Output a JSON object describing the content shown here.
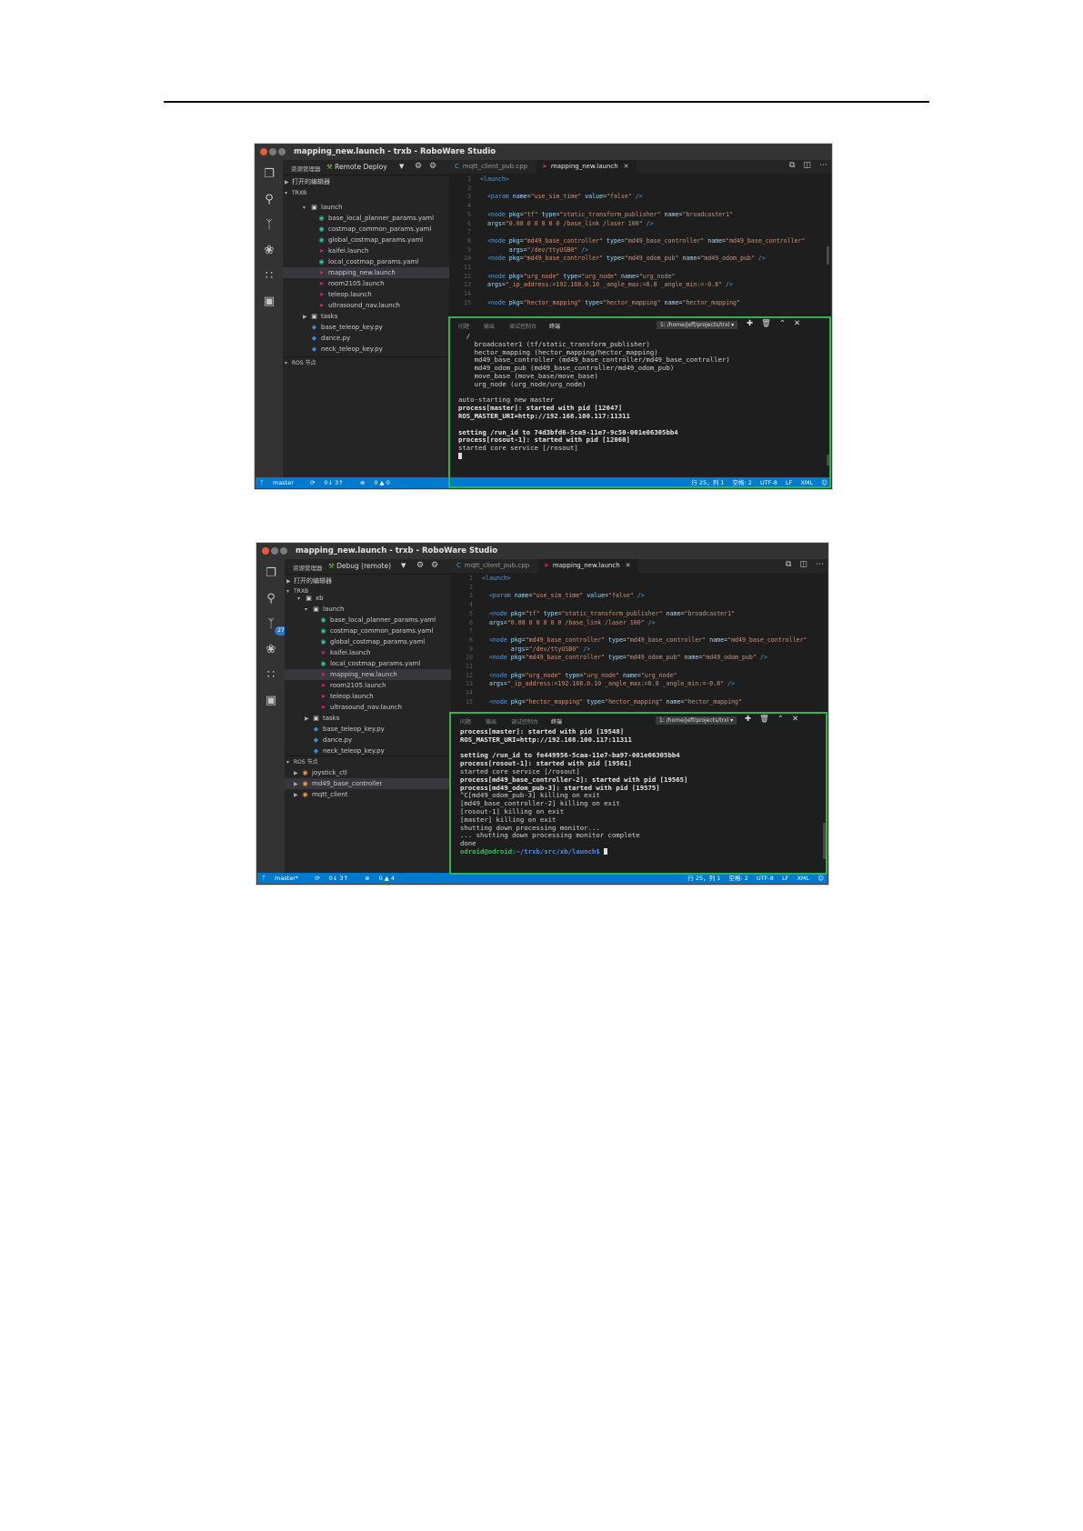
{
  "colors": {
    "accent": "#007acc",
    "highlight_box": "#2fb34a",
    "prompt_green": "#39c057"
  },
  "windows": [
    {
      "title": "mapping_new.launch - trxb - RoboWare Studio",
      "sidebar": {
        "header": "资源管理器",
        "mode": "Remote Deploy",
        "tree": [
          {
            "label": "打开的编辑器",
            "kind": "section"
          },
          {
            "label": "TRXB",
            "kind": "section"
          },
          {
            "label": "launch",
            "kind": "folder"
          },
          {
            "label": "base_local_planner_params.yaml",
            "kind": "yaml"
          },
          {
            "label": "costmap_common_params.yaml",
            "kind": "yaml"
          },
          {
            "label": "global_costmap_params.yaml",
            "kind": "yaml"
          },
          {
            "label": "kaifei.launch",
            "kind": "launch"
          },
          {
            "label": "local_costmap_params.yaml",
            "kind": "yaml"
          },
          {
            "label": "mapping_new.launch",
            "kind": "launch",
            "selected": true
          },
          {
            "label": "room2105.launch",
            "kind": "launch"
          },
          {
            "label": "teleop.launch",
            "kind": "launch"
          },
          {
            "label": "ultrasound_nav.launch",
            "kind": "launch"
          },
          {
            "label": "tasks",
            "kind": "folder"
          },
          {
            "label": "base_teleop_key.py",
            "kind": "py"
          },
          {
            "label": "dance.py",
            "kind": "py"
          },
          {
            "label": "neck_teleop_key.py",
            "kind": "py"
          },
          {
            "label": "ROS 节点",
            "kind": "section"
          }
        ]
      },
      "tabs": [
        {
          "label": "mqtt_client_pub.cpp",
          "active": false
        },
        {
          "label": "mapping_new.launch",
          "active": true
        }
      ],
      "panel": {
        "tabs": [
          "问题",
          "输出",
          "调试控制台",
          "终端"
        ],
        "active_tab": "终端",
        "terminal_select": "1: /home/jeff/projects/trxl",
        "lines": [
          "  /",
          "    broadcaster1 (tf/static_transform_publisher)",
          "    hector_mapping (hector_mapping/hector_mapping)",
          "    md49_base_controller (md49_base_controller/md49_base_controller)",
          "    md49_odom_pub (md49_base_controller/md49_odom_pub)",
          "    move_base (move_base/move_base)",
          "    urg_node (urg_node/urg_node)",
          "",
          "auto-starting new master",
          "process[master]: started with pid [12047]",
          "ROS_MASTER_URI=http://192.168.100.117:11311",
          "",
          "setting /run_id to 74d3bfd6-5ca9-11e7-9c50-001e06305bb4",
          "process[rosout-1]: started with pid [12060]",
          "started core service [/rosout]"
        ],
        "bold_lines": [
          9,
          10,
          12,
          13
        ]
      },
      "status": {
        "branch": "master",
        "sync": "0↓ 3↑",
        "problems": "0 ▲ 0",
        "position": "行 25，列 1",
        "indent": "空格: 2",
        "encoding": "UTF-8",
        "eol": "LF",
        "lang": "XML"
      }
    },
    {
      "title": "mapping_new.launch - trxb - RoboWare Studio",
      "sidebar": {
        "header": "资源管理器",
        "mode": "Debug (remote)",
        "badge": "27",
        "tree": [
          {
            "label": "打开的编辑器",
            "kind": "section"
          },
          {
            "label": "TRXB",
            "kind": "section"
          },
          {
            "label": "xb",
            "kind": "folder"
          },
          {
            "label": "launch",
            "kind": "folder"
          },
          {
            "label": "base_local_planner_params.yaml",
            "kind": "yaml"
          },
          {
            "label": "costmap_common_params.yaml",
            "kind": "yaml"
          },
          {
            "label": "global_costmap_params.yaml",
            "kind": "yaml"
          },
          {
            "label": "kaifei.launch",
            "kind": "launch"
          },
          {
            "label": "local_costmap_params.yaml",
            "kind": "yaml"
          },
          {
            "label": "mapping_new.launch",
            "kind": "launch",
            "selected": true
          },
          {
            "label": "room2105.launch",
            "kind": "launch"
          },
          {
            "label": "teleop.launch",
            "kind": "launch"
          },
          {
            "label": "ultrasound_nav.launch",
            "kind": "launch"
          },
          {
            "label": "tasks",
            "kind": "folder"
          },
          {
            "label": "base_teleop_key.py",
            "kind": "py"
          },
          {
            "label": "dance.py",
            "kind": "py"
          },
          {
            "label": "neck_teleop_key.py",
            "kind": "py"
          },
          {
            "label": "ROS 节点",
            "kind": "section"
          },
          {
            "label": "joystick_ctl",
            "kind": "pkg"
          },
          {
            "label": "md49_base_controller",
            "kind": "pkg",
            "selected": true
          },
          {
            "label": "mqtt_client",
            "kind": "pkg"
          }
        ]
      },
      "tabs": [
        {
          "label": "mqtt_client_pub.cpp",
          "active": false
        },
        {
          "label": "mapping_new.launch",
          "active": true
        }
      ],
      "panel": {
        "tabs": [
          "问题",
          "输出",
          "调试控制台",
          "终端"
        ],
        "active_tab": "终端",
        "terminal_select": "1: /home/jeff/projects/trxl",
        "lines": [
          "process[master]: started with pid [19548]",
          "ROS_MASTER_URI=http://192.168.100.117:11311",
          "",
          "setting /run_id to fe449956-5caa-11e7-ba97-001e06305bb4",
          "process[rosout-1]: started with pid [19561]",
          "started core service [/rosout]",
          "process[md49_base_controller-2]: started with pid [19565]",
          "process[md49_odom_pub-3]: started with pid [19575]",
          "^C[md49_odom_pub-3] killing on exit",
          "[md49_base_controller-2] killing on exit",
          "[rosout-1] killing on exit",
          "[master] killing on exit",
          "shutting down processing monitor...",
          "... shutting down processing monitor complete",
          "done"
        ],
        "bold_lines": [
          0,
          1,
          3,
          4,
          6,
          7
        ],
        "prompt_user": "odroid@odroid",
        "prompt_path": ":~/trxb/src/xb/launch$"
      },
      "status": {
        "branch": "master*",
        "sync": "0↓ 3↑",
        "problems": "0 ▲ 4",
        "position": "行 25，列 1",
        "indent": "空格: 2",
        "encoding": "UTF-8",
        "eol": "LF",
        "lang": "XML"
      }
    }
  ],
  "editor": {
    "lines": [
      {
        "n": "1",
        "text": "<launch>"
      },
      {
        "n": "2",
        "text": ""
      },
      {
        "n": "3",
        "text": "  <param name=\"use_sim_time\" value=\"false\" />"
      },
      {
        "n": "4",
        "text": ""
      },
      {
        "n": "5",
        "text": "  <node pkg=\"tf\" type=\"static_transform_publisher\" name=\"broadcaster1\""
      },
      {
        "n": "6",
        "text": "  args=\"0.08 0 0 0 0 0 /base_link /laser 100\" />"
      },
      {
        "n": "7",
        "text": ""
      },
      {
        "n": "8",
        "text": "  <node pkg=\"md49_base_controller\" type=\"md49_base_controller\" name=\"md49_base_controller\""
      },
      {
        "n": "9",
        "text": "        args=\"/dev/ttyUSB0\" />"
      },
      {
        "n": "10",
        "text": "  <node pkg=\"md49_base_controller\" type=\"md49_odom_pub\" name=\"md49_odom_pub\" />"
      },
      {
        "n": "11",
        "text": ""
      },
      {
        "n": "12",
        "text": "  <node pkg=\"urg_node\" type=\"urg_node\" name=\"urg_node\""
      },
      {
        "n": "13",
        "text": "  args=\"_ip_address:=192.168.0.10 _angle_max:=0.8 _angle_min:=-0.8\" />"
      },
      {
        "n": "14",
        "text": ""
      },
      {
        "n": "15",
        "text": "  <node pkg=\"hector_mapping\" type=\"hector_mapping\" name=\"hector_mapping\""
      }
    ]
  }
}
